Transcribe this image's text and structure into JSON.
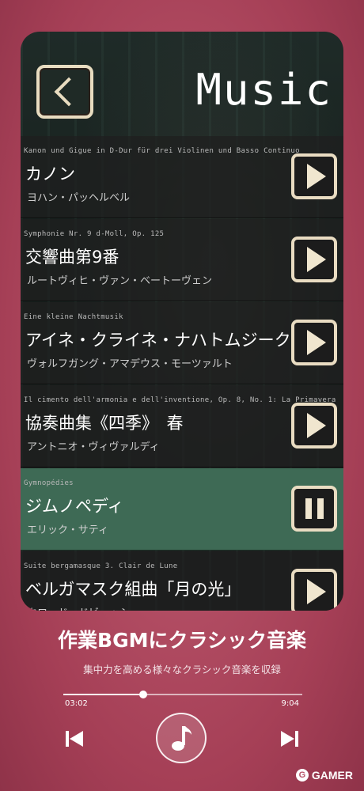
{
  "header": {
    "title": "Music",
    "back_icon": "chevron-left-icon"
  },
  "tracks": [
    {
      "original": "Kanon und Gigue in D-Dur für drei Violinen und Basso Continuo",
      "title": "カノン",
      "composer": "ヨハン・パッヘルベル",
      "state": "play"
    },
    {
      "original": "Symphonie Nr. 9 d-Moll, Op. 125",
      "title": "交響曲第9番",
      "composer": "ルートヴィヒ・ヴァン・ベートーヴェン",
      "state": "play"
    },
    {
      "original": "Eine kleine Nachtmusik",
      "title": "アイネ・クライネ・ナハトムジーク",
      "composer": "ヴォルフガング・アマデウス・モーツァルト",
      "state": "play"
    },
    {
      "original": "Il cimento dell'armonia e dell'inventione, Op. 8, No. 1: La Primavera",
      "title": "協奏曲集《四季》　春",
      "composer": "アントニオ・ヴィヴァルディ",
      "state": "play"
    },
    {
      "original": "Gymnopédies",
      "title": "ジムノペディ",
      "composer": "エリック・サティ",
      "state": "pause"
    },
    {
      "original": "Suite bergamasque 3. Clair de Lune",
      "title": "ベルガマスク組曲「月の光」",
      "composer": "クロード・ドビュッシー",
      "state": "play"
    }
  ],
  "promo": {
    "headline": "作業BGMにクラシック音楽",
    "subline": "集中力を高める様々なクラシック音楽を収録"
  },
  "player": {
    "current_time": "03:02",
    "total_time": "9:04",
    "progress": 0.335,
    "icons": [
      "skip-previous-icon",
      "music-note-icon",
      "skip-next-icon"
    ]
  },
  "watermark": {
    "text": "GAMER"
  },
  "colors": {
    "background": "#b8546a",
    "active_row": "#3e6a55",
    "button_border": "#e9dcc2"
  }
}
